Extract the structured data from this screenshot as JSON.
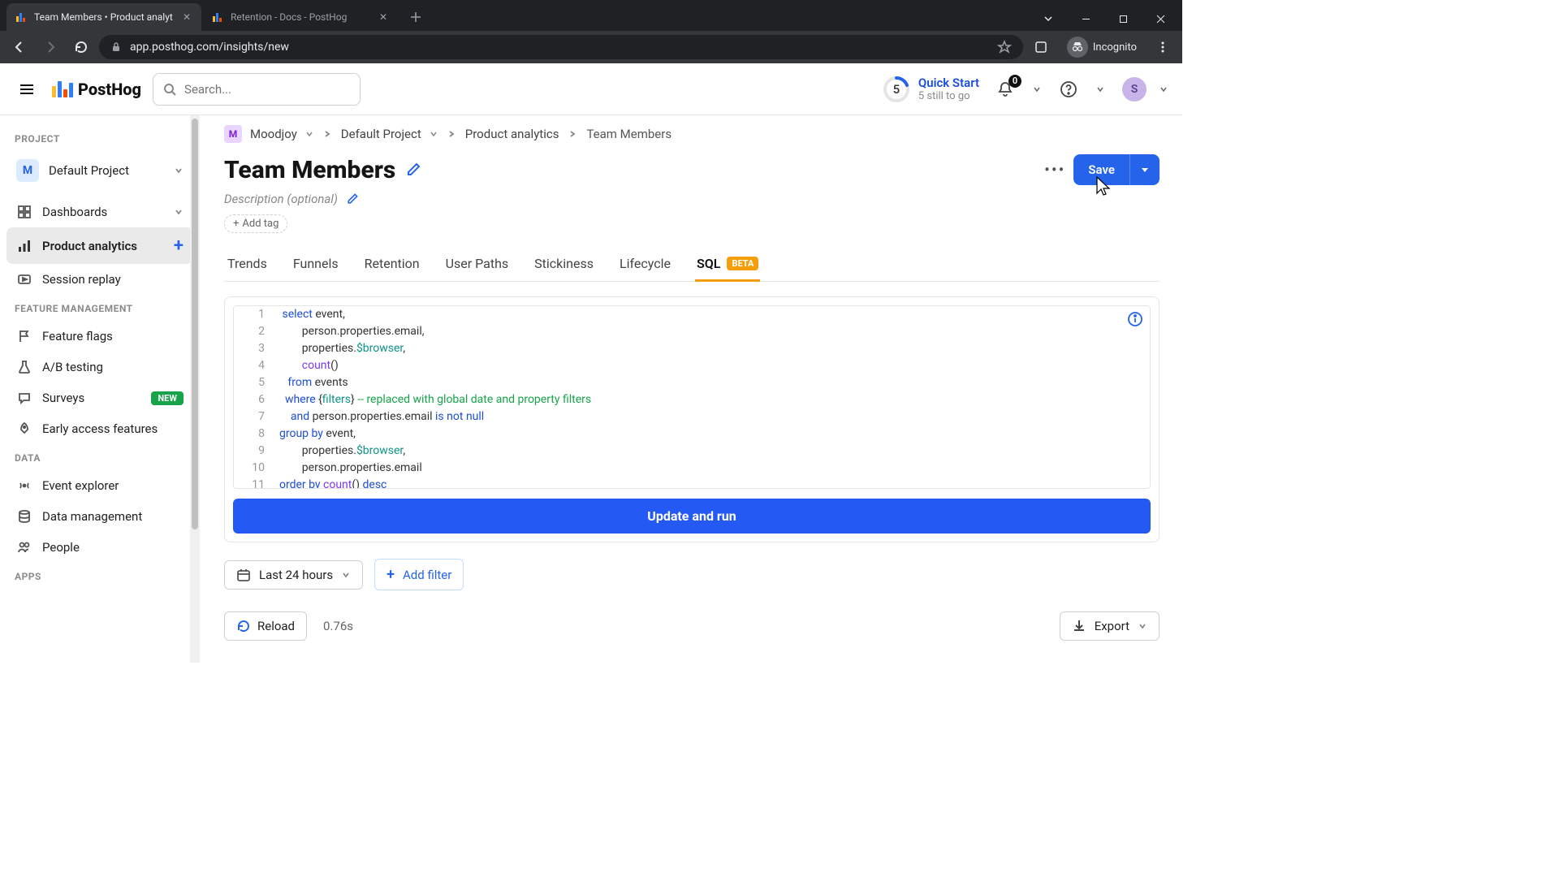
{
  "browser": {
    "tabs": [
      {
        "title": "Team Members • Product analyt",
        "active": true
      },
      {
        "title": "Retention - Docs - PostHog",
        "active": false
      }
    ],
    "url": "app.posthog.com/insights/new",
    "incognito_label": "Incognito"
  },
  "header": {
    "logo_text": "PostHog",
    "search_placeholder": "Search...",
    "quickstart_title": "Quick Start",
    "quickstart_sub": "5 still to go",
    "quickstart_count": "5",
    "notif_count": "0",
    "avatar_initial": "S"
  },
  "sidebar": {
    "sections": {
      "project": {
        "label": "PROJECT",
        "item": "Default Project",
        "initial": "M"
      },
      "nav": [
        {
          "icon": "dashboard",
          "label": "Dashboards",
          "tail": "chev"
        },
        {
          "icon": "trend",
          "label": "Product analytics",
          "active": true,
          "tail": "plus"
        },
        {
          "icon": "play",
          "label": "Session replay"
        }
      ],
      "feature": {
        "label": "FEATURE MANAGEMENT",
        "items": [
          {
            "icon": "flag",
            "label": "Feature flags"
          },
          {
            "icon": "flask",
            "label": "A/B testing"
          },
          {
            "icon": "chat",
            "label": "Surveys",
            "badge": "NEW"
          },
          {
            "icon": "rocket",
            "label": "Early access features"
          }
        ]
      },
      "data": {
        "label": "DATA",
        "items": [
          {
            "icon": "signal",
            "label": "Event explorer"
          },
          {
            "icon": "db",
            "label": "Data management"
          },
          {
            "icon": "people",
            "label": "People"
          }
        ]
      },
      "apps": {
        "label": "APPS"
      }
    }
  },
  "breadcrumb": {
    "org_initial": "M",
    "org": "Moodjoy",
    "project": "Default Project",
    "section": "Product analytics",
    "page": "Team Members"
  },
  "page": {
    "title": "Team Members",
    "description_placeholder": "Description (optional)",
    "add_tag": "Add tag",
    "more": "•••",
    "save": "Save"
  },
  "tabs": [
    {
      "label": "Trends"
    },
    {
      "label": "Funnels"
    },
    {
      "label": "Retention"
    },
    {
      "label": "User Paths"
    },
    {
      "label": "Stickiness"
    },
    {
      "label": "Lifecycle"
    },
    {
      "label": "SQL",
      "active": true,
      "badge": "BETA"
    }
  ],
  "editor": {
    "run_label": "Update and run"
  },
  "filters": {
    "date": "Last 24 hours",
    "add_filter": "Add filter"
  },
  "footer": {
    "reload": "Reload",
    "timing": "0.76s",
    "export": "Export"
  }
}
